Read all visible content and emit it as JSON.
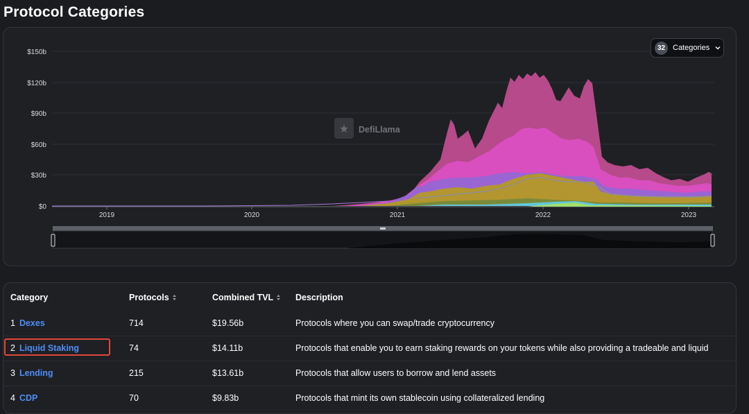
{
  "page": {
    "title": "Protocol Categories"
  },
  "chart": {
    "categories_count": "32",
    "categories_label": "Categories",
    "watermark": "DefiLlama",
    "y_ticks": [
      "$150b",
      "$120b",
      "$90b",
      "$60b",
      "$30b",
      "$0"
    ],
    "x_ticks": [
      "2019",
      "2020",
      "2021",
      "2022",
      "2023"
    ]
  },
  "chart_data": {
    "type": "area",
    "title": "",
    "xlabel": "",
    "ylabel": "",
    "ylim": [
      0,
      150
    ],
    "x": [
      "2019",
      "2020",
      "2021",
      "2022",
      "2023"
    ],
    "series": [
      {
        "color": "#b64a8a",
        "values": [
          0,
          0,
          2,
          128,
          31
        ]
      },
      {
        "color": "#d94fbf",
        "values": [
          0,
          0,
          1,
          70,
          20
        ]
      },
      {
        "color": "#b3962f",
        "values": [
          0,
          0,
          1,
          30,
          10
        ]
      }
    ]
  },
  "table": {
    "headers": {
      "category": "Category",
      "protocols": "Protocols",
      "tvl": "Combined TVL",
      "description": "Description"
    },
    "rows": [
      {
        "rank": "1",
        "name": "Dexes",
        "protocols": "714",
        "tvl": "$19.56b",
        "description": "Protocols where you can swap/trade cryptocurrency"
      },
      {
        "rank": "2",
        "name": "Liquid Staking",
        "protocols": "74",
        "tvl": "$14.11b",
        "description": "Protocols that enable you to earn staking rewards on your tokens while also providing a tradeable and liquid"
      },
      {
        "rank": "3",
        "name": "Lending",
        "protocols": "215",
        "tvl": "$13.61b",
        "description": "Protocols that allow users to borrow and lend assets"
      },
      {
        "rank": "4",
        "name": "CDP",
        "protocols": "70",
        "tvl": "$9.83b",
        "description": "Protocols that mint its own stablecoin using collateralized lending"
      }
    ]
  }
}
